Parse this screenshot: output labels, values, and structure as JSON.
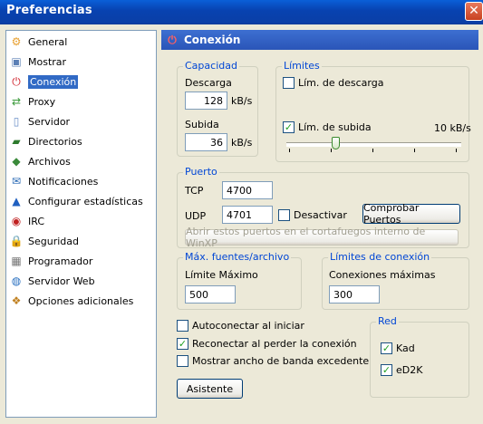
{
  "window": {
    "title": "Preferencias",
    "close_label": "✕"
  },
  "sidebar": {
    "items": [
      {
        "label": "General",
        "icon": "gear-icon",
        "glyph": "⚙",
        "color": "#e8a030"
      },
      {
        "label": "Mostrar",
        "icon": "monitor-icon",
        "glyph": "▣",
        "color": "#5b7fb5"
      },
      {
        "label": "Conexión",
        "icon": "plug-icon",
        "glyph": "⏻",
        "color": "#d0202a",
        "selected": true
      },
      {
        "label": "Proxy",
        "icon": "proxy-icon",
        "glyph": "⇄",
        "color": "#3a9a3a"
      },
      {
        "label": "Servidor",
        "icon": "server-icon",
        "glyph": "▯",
        "color": "#6b8fc8"
      },
      {
        "label": "Directorios",
        "icon": "folders-icon",
        "glyph": "▰",
        "color": "#2d7a2d"
      },
      {
        "label": "Archivos",
        "icon": "files-icon",
        "glyph": "◆",
        "color": "#3a8a3a"
      },
      {
        "label": "Notificaciones",
        "icon": "notification-icon",
        "glyph": "✉",
        "color": "#2a6ab5"
      },
      {
        "label": "Configurar estadísticas",
        "icon": "statistics-icon",
        "glyph": "▲",
        "color": "#2060c0"
      },
      {
        "label": "IRC",
        "icon": "irc-icon",
        "glyph": "◉",
        "color": "#c02020"
      },
      {
        "label": "Seguridad",
        "icon": "lock-icon",
        "glyph": "🔒",
        "color": "#d0a020"
      },
      {
        "label": "Programador",
        "icon": "calendar-icon",
        "glyph": "▦",
        "color": "#777777"
      },
      {
        "label": "Servidor Web",
        "icon": "globe-icon",
        "glyph": "◍",
        "color": "#2a70c0"
      },
      {
        "label": "Opciones adicionales",
        "icon": "options-icon",
        "glyph": "❖",
        "color": "#c08020"
      }
    ]
  },
  "panel": {
    "title": "Conexión",
    "capacidad": {
      "legend": "Capacidad",
      "descarga_label": "Descarga",
      "descarga_value": "128",
      "descarga_unit": "kB/s",
      "subida_label": "Subida",
      "subida_value": "36",
      "subida_unit": "kB/s"
    },
    "limites": {
      "legend": "Límites",
      "lim_descarga_label": "Lím. de descarga",
      "lim_descarga_checked": false,
      "lim_subida_label": "Lím. de subida",
      "lim_subida_checked": true,
      "lim_subida_value": "10 kB/s",
      "slider_fraction": 0.28
    },
    "puerto": {
      "legend": "Puerto",
      "tcp_label": "TCP",
      "tcp_value": "4700",
      "udp_label": "UDP",
      "udp_value": "4701",
      "desactivar_label": "Desactivar",
      "comprobar_label": "Comprobar Puertos",
      "firewall_label": "Abrir estos puertos en el cortafuegos interno de WinXP"
    },
    "fuentes": {
      "legend": "Máx. fuentes/archivo",
      "limite_label": "Límite Máximo",
      "limite_value": "500"
    },
    "conexion_limits": {
      "legend": "Límites de conexión",
      "max_label": "Conexiones máximas",
      "max_value": "300"
    },
    "options": {
      "autoconectar": "Autoconectar al iniciar",
      "autoconectar_checked": false,
      "reconectar": "Reconectar al perder la conexión",
      "reconectar_checked": true,
      "mostrar_ancho": "Mostrar ancho de banda excedente",
      "mostrar_ancho_checked": false,
      "asistente_label": "Asistente"
    },
    "red": {
      "legend": "Red",
      "kad_label": "Kad",
      "kad_checked": true,
      "ed2k_label": "eD2K",
      "ed2k_checked": true
    }
  },
  "check_glyph": "✓"
}
